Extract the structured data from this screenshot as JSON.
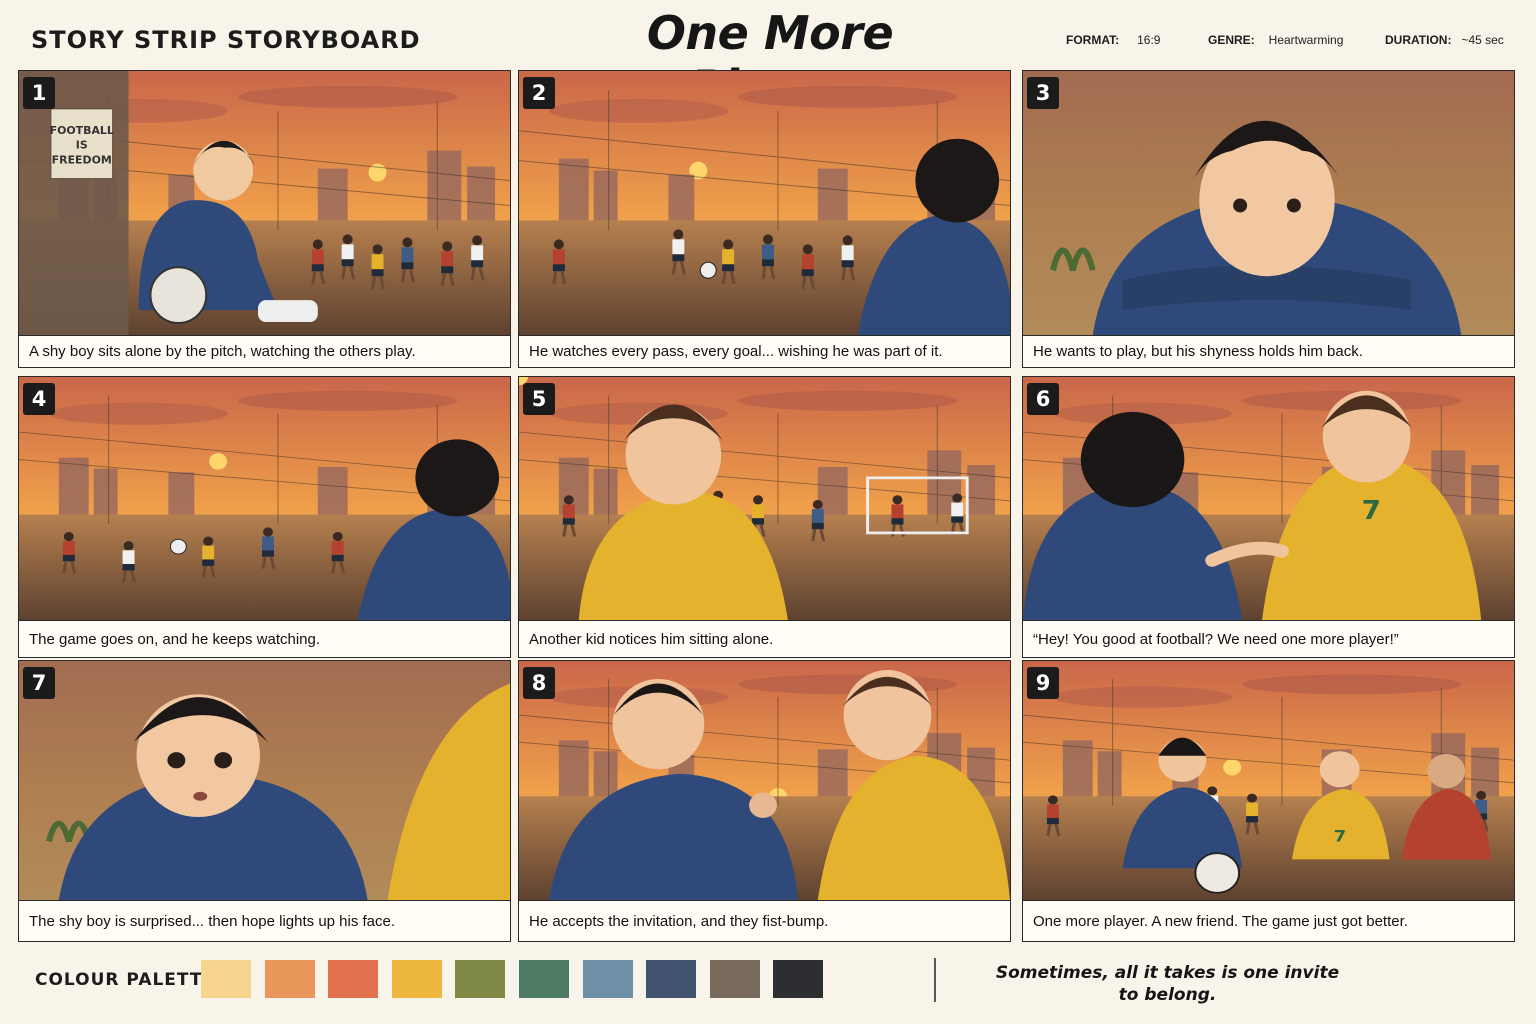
{
  "header": {
    "kicker": "STORY STRIP STORYBOARD",
    "title": "One More Player",
    "format_label": "FORMAT:",
    "format_value": "16:9",
    "genre_label": "GENRE:",
    "genre_value": "Heartwarming",
    "duration_label": "DURATION:",
    "duration_value": "~45 sec"
  },
  "panels": [
    {
      "number": "1",
      "caption": "A shy boy sits alone by the pitch, watching the others play.",
      "sign_text": "FOOTBALL IS FREEDOM"
    },
    {
      "number": "2",
      "caption": "He watches every pass, every goal... wishing he was part of it."
    },
    {
      "number": "3",
      "caption": "He wants to play, but his shyness holds him back."
    },
    {
      "number": "4",
      "caption": "The game goes on, and he keeps watching."
    },
    {
      "number": "5",
      "caption": "Another kid notices him sitting alone."
    },
    {
      "number": "6",
      "caption": "“Hey! You good at football? We need one more player!”",
      "jersey_number": "7"
    },
    {
      "number": "7",
      "caption": "The shy boy is surprised... then hope lights up his face."
    },
    {
      "number": "8",
      "caption": "He accepts the invitation, and they fist-bump."
    },
    {
      "number": "9",
      "caption": "One more player. A new friend. The game just got better.",
      "jersey_number": "7"
    }
  ],
  "footer": {
    "palette_label": "COLOUR PALETTE",
    "palette": [
      "#f6d58f",
      "#e9975a",
      "#e0714d",
      "#eeb73f",
      "#7f8845",
      "#4c7a62",
      "#6f8fa8",
      "#41536f",
      "#776a5c",
      "#2c2e32"
    ],
    "tagline_line1": "Sometimes, all it takes is one invite",
    "tagline_line2": "to belong."
  },
  "colors": {
    "sky_top": "#c9674a",
    "sky_mid": "#f0a04a",
    "sun": "#ffd66b",
    "ground": "#8a6448",
    "hoodie": "#2f4a7a",
    "jersey_yellow": "#e5b22e",
    "jersey_red": "#b5412f"
  }
}
